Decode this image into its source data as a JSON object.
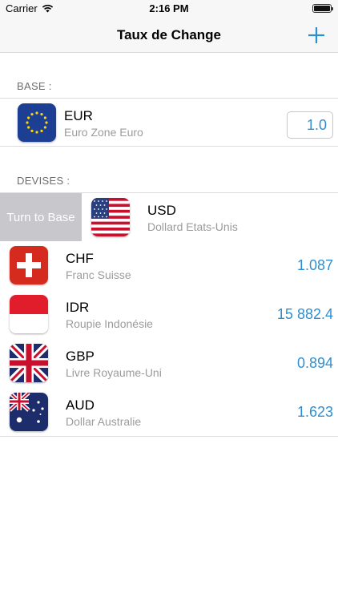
{
  "status_bar": {
    "carrier": "Carrier",
    "time": "2:16 PM"
  },
  "nav": {
    "title": "Taux de Change",
    "add_icon": "plus-icon"
  },
  "base": {
    "header": "BASE :",
    "code": "EUR",
    "name": "Euro Zone Euro",
    "amount": "1.0"
  },
  "devises": {
    "header": "DEVISES :",
    "swipe_action": "Turn to Base",
    "items": [
      {
        "code": "USD",
        "name": "Dollard Etats-Unis",
        "rate": ""
      },
      {
        "code": "CHF",
        "name": "Franc Suisse",
        "rate": "1.087"
      },
      {
        "code": "IDR",
        "name": "Roupie Indonésie",
        "rate": "15 882.4"
      },
      {
        "code": "GBP",
        "name": "Livre Royaume-Uni",
        "rate": "0.894"
      },
      {
        "code": "AUD",
        "name": "Dollar Australie",
        "rate": "1.623"
      }
    ]
  },
  "colors": {
    "accent": "#2f8ed1",
    "swipe_bg": "#c7c7cc"
  }
}
